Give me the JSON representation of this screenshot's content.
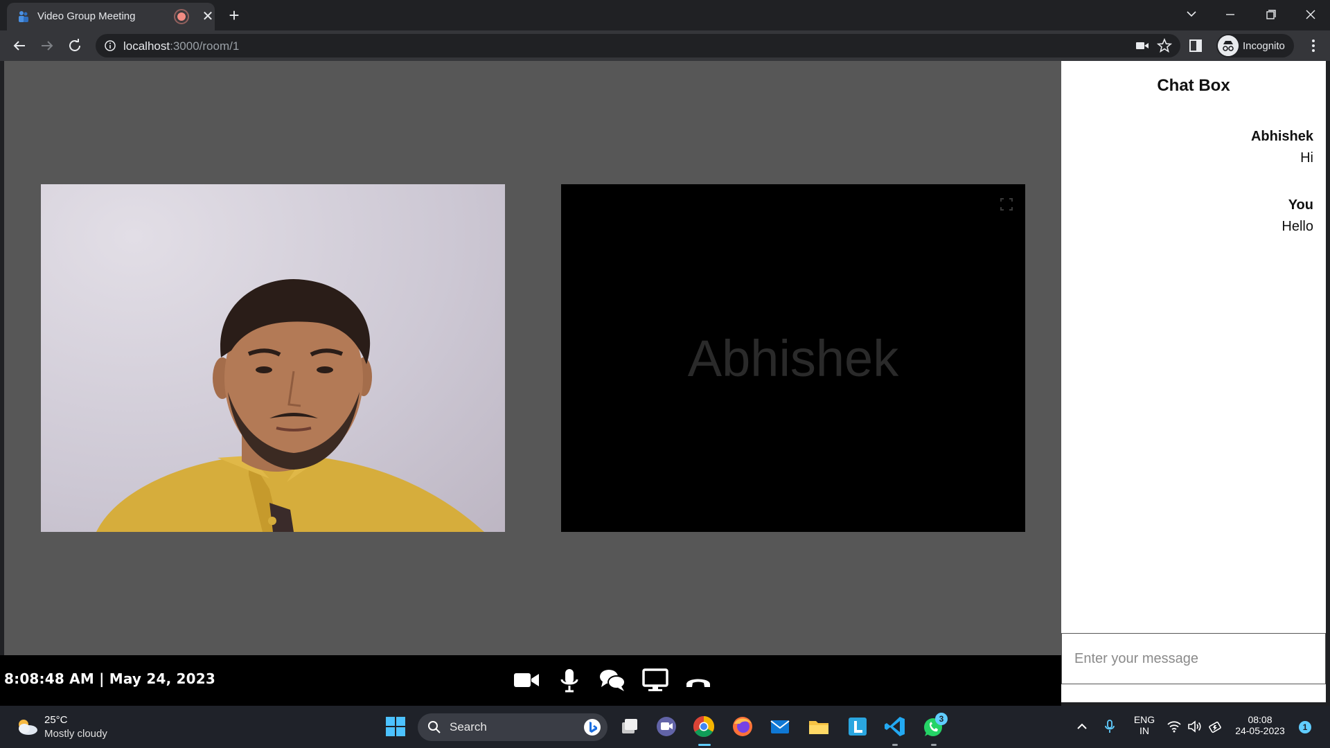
{
  "browser": {
    "tab_title": "Video Group Meeting",
    "url_host": "localhost",
    "url_path": ":3000/room/1",
    "profile_label": "Incognito"
  },
  "meeting": {
    "remote_participant_name": "Abhishek",
    "clock": "8:08:48 AM | May 24, 2023",
    "controls": [
      "video-camera-icon",
      "microphone-icon",
      "chat-icon",
      "screen-share-icon",
      "end-call-icon"
    ]
  },
  "chat": {
    "title": "Chat Box",
    "messages": [
      {
        "sender": "Abhishek",
        "text": "Hi"
      },
      {
        "sender": "You",
        "text": "Hello"
      }
    ],
    "input_placeholder": "Enter your message"
  },
  "taskbar": {
    "weather_temp": "25°C",
    "weather_desc": "Mostly cloudy",
    "search_label": "Search",
    "whatsapp_badge": "3",
    "lang_top": "ENG",
    "lang_bottom": "IN",
    "time": "08:08",
    "date": "24-05-2023",
    "notification_count": "1"
  },
  "colors": {
    "video_area_bg": "#575757",
    "control_bar_bg": "#000000",
    "chat_bg": "#ffffff",
    "accent": "#60cdff"
  }
}
